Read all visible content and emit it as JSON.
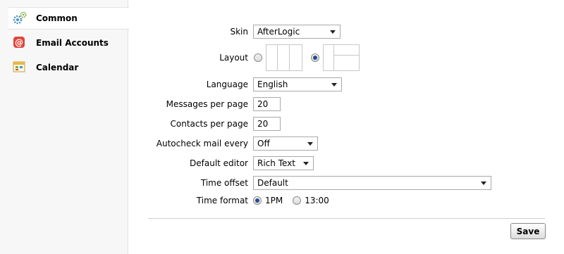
{
  "sidebar": {
    "items": [
      {
        "label": "Common",
        "icon": "gears-icon",
        "active": true
      },
      {
        "label": "Email Accounts",
        "icon": "at-sign-icon",
        "active": false
      },
      {
        "label": "Calendar",
        "icon": "calendar-icon",
        "active": false
      }
    ]
  },
  "form": {
    "skin": {
      "label": "Skin",
      "value": "AfterLogic"
    },
    "layout": {
      "label": "Layout",
      "selected": "horizontal"
    },
    "language": {
      "label": "Language",
      "value": "English"
    },
    "messages_per_page": {
      "label": "Messages per page",
      "value": "20"
    },
    "contacts_per_page": {
      "label": "Contacts per page",
      "value": "20"
    },
    "autocheck": {
      "label": "Autocheck mail every",
      "value": "Off"
    },
    "default_editor": {
      "label": "Default editor",
      "value": "Rich Text"
    },
    "time_offset": {
      "label": "Time offset",
      "value": "Default"
    },
    "time_format": {
      "label": "Time format",
      "option1": "1PM",
      "option2": "13:00",
      "selected": "1PM"
    }
  },
  "actions": {
    "save_label": "Save"
  },
  "colors": {
    "accent": "#1f4f8f",
    "sidebar_bg": "#f7f7f7",
    "email_icon": "#e0453a",
    "gear_icon": "#4a90c8"
  }
}
